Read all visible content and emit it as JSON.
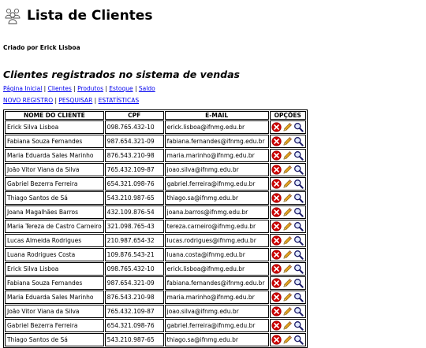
{
  "page": {
    "title": "Lista de Clientes",
    "author": "Criado por Erick Lisboa",
    "subtitle": "Clientes registrados no sistema de vendas"
  },
  "nav_primary": [
    "Página Inicial",
    "Clientes",
    "Produtos",
    "Estoque",
    "Saldo"
  ],
  "nav_secondary": [
    "NOVO REGISTRO",
    "PESQUISAR",
    "ESTATÍSTICAS"
  ],
  "table": {
    "headers": [
      "NOME DO CLIENTE",
      "CPF",
      "E-MAIL",
      "OPÇÕES"
    ],
    "rows": [
      [
        "Erick Silva Lisboa",
        "098.765.432-10",
        "erick.lisboa@ifnmg.edu.br"
      ],
      [
        "Fabiana Souza Fernandes",
        "987.654.321-09",
        "fabiana.fernandes@ifnmg.edu.br"
      ],
      [
        "Maria Eduarda Sales Marinho",
        "876.543.210-98",
        "maria.marinho@ifnmg.edu.br"
      ],
      [
        "João Vitor Viana da Silva",
        "765.432.109-87",
        "joao.silva@ifnmg.edu.br"
      ],
      [
        "Gabriel Bezerra Ferreira",
        "654.321.098-76",
        "gabriel.ferreira@ifnmg.edu.br"
      ],
      [
        "Thiago Santos de Sá",
        "543.210.987-65",
        "thiago.sa@ifnmg.edu.br"
      ],
      [
        "Joana Magalhães Barros",
        "432.109.876-54",
        "joana.barros@ifnmg.edu.br"
      ],
      [
        "Maria Tereza de Castro Carneiro",
        "321.098.765-43",
        "tereza.carneiro@ifnmg.edu.br"
      ],
      [
        "Lucas Almeida Rodrigues",
        "210.987.654-32",
        "lucas.rodrigues@ifnmg.edu.br"
      ],
      [
        "Luana Rodrigues Costa",
        "109.876.543-21",
        "luana.costa@ifnmg.edu.br"
      ],
      [
        "Erick Silva Lisboa",
        "098.765.432-10",
        "erick.lisboa@ifnmg.edu.br"
      ],
      [
        "Fabiana Souza Fernandes",
        "987.654.321-09",
        "fabiana.fernandes@ifnmg.edu.br"
      ],
      [
        "Maria Eduarda Sales Marinho",
        "876.543.210-98",
        "maria.marinho@ifnmg.edu.br"
      ],
      [
        "João Vitor Viana da Silva",
        "765.432.109-87",
        "joao.silva@ifnmg.edu.br"
      ],
      [
        "Gabriel Bezerra Ferreira",
        "654.321.098-76",
        "gabriel.ferreira@ifnmg.edu.br"
      ],
      [
        "Thiago Santos de Sá",
        "543.210.987-65",
        "thiago.sa@ifnmg.edu.br"
      ]
    ],
    "row_icons": [
      "delete-icon",
      "edit-pencil-icon",
      "search-magnifier-icon"
    ]
  },
  "colors": {
    "link": "#0000ee",
    "delete": "#cc0000",
    "pencil": "#e0a020",
    "magnifier": "#1a1a66"
  }
}
